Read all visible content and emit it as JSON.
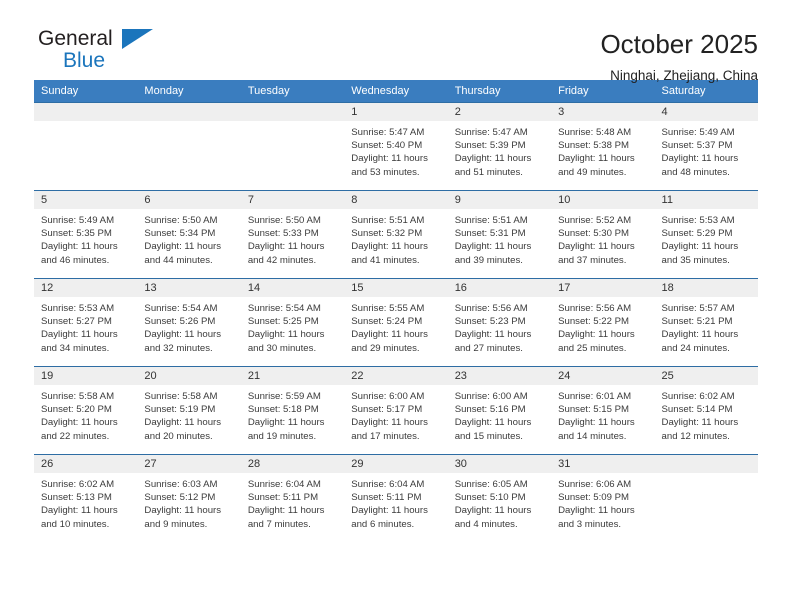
{
  "brand": {
    "name_part1": "General",
    "name_part2": "Blue",
    "accent_color": "#1b75bc",
    "logo_icon": "triangle-icon"
  },
  "header": {
    "title": "October 2025",
    "subtitle": "Ninghai, Zhejiang, China"
  },
  "calendar": {
    "header_bg": "#3a7dbf",
    "daynum_bg": "#efefef",
    "weekday_headers": [
      "Sunday",
      "Monday",
      "Tuesday",
      "Wednesday",
      "Thursday",
      "Friday",
      "Saturday"
    ],
    "weeks": [
      [
        {
          "day": "",
          "empty": true
        },
        {
          "day": "",
          "empty": true
        },
        {
          "day": "",
          "empty": true
        },
        {
          "day": "1",
          "sunrise": "Sunrise: 5:47 AM",
          "sunset": "Sunset: 5:40 PM",
          "daylight1": "Daylight: 11 hours",
          "daylight2": "and 53 minutes."
        },
        {
          "day": "2",
          "sunrise": "Sunrise: 5:47 AM",
          "sunset": "Sunset: 5:39 PM",
          "daylight1": "Daylight: 11 hours",
          "daylight2": "and 51 minutes."
        },
        {
          "day": "3",
          "sunrise": "Sunrise: 5:48 AM",
          "sunset": "Sunset: 5:38 PM",
          "daylight1": "Daylight: 11 hours",
          "daylight2": "and 49 minutes."
        },
        {
          "day": "4",
          "sunrise": "Sunrise: 5:49 AM",
          "sunset": "Sunset: 5:37 PM",
          "daylight1": "Daylight: 11 hours",
          "daylight2": "and 48 minutes."
        }
      ],
      [
        {
          "day": "5",
          "sunrise": "Sunrise: 5:49 AM",
          "sunset": "Sunset: 5:35 PM",
          "daylight1": "Daylight: 11 hours",
          "daylight2": "and 46 minutes."
        },
        {
          "day": "6",
          "sunrise": "Sunrise: 5:50 AM",
          "sunset": "Sunset: 5:34 PM",
          "daylight1": "Daylight: 11 hours",
          "daylight2": "and 44 minutes."
        },
        {
          "day": "7",
          "sunrise": "Sunrise: 5:50 AM",
          "sunset": "Sunset: 5:33 PM",
          "daylight1": "Daylight: 11 hours",
          "daylight2": "and 42 minutes."
        },
        {
          "day": "8",
          "sunrise": "Sunrise: 5:51 AM",
          "sunset": "Sunset: 5:32 PM",
          "daylight1": "Daylight: 11 hours",
          "daylight2": "and 41 minutes."
        },
        {
          "day": "9",
          "sunrise": "Sunrise: 5:51 AM",
          "sunset": "Sunset: 5:31 PM",
          "daylight1": "Daylight: 11 hours",
          "daylight2": "and 39 minutes."
        },
        {
          "day": "10",
          "sunrise": "Sunrise: 5:52 AM",
          "sunset": "Sunset: 5:30 PM",
          "daylight1": "Daylight: 11 hours",
          "daylight2": "and 37 minutes."
        },
        {
          "day": "11",
          "sunrise": "Sunrise: 5:53 AM",
          "sunset": "Sunset: 5:29 PM",
          "daylight1": "Daylight: 11 hours",
          "daylight2": "and 35 minutes."
        }
      ],
      [
        {
          "day": "12",
          "sunrise": "Sunrise: 5:53 AM",
          "sunset": "Sunset: 5:27 PM",
          "daylight1": "Daylight: 11 hours",
          "daylight2": "and 34 minutes."
        },
        {
          "day": "13",
          "sunrise": "Sunrise: 5:54 AM",
          "sunset": "Sunset: 5:26 PM",
          "daylight1": "Daylight: 11 hours",
          "daylight2": "and 32 minutes."
        },
        {
          "day": "14",
          "sunrise": "Sunrise: 5:54 AM",
          "sunset": "Sunset: 5:25 PM",
          "daylight1": "Daylight: 11 hours",
          "daylight2": "and 30 minutes."
        },
        {
          "day": "15",
          "sunrise": "Sunrise: 5:55 AM",
          "sunset": "Sunset: 5:24 PM",
          "daylight1": "Daylight: 11 hours",
          "daylight2": "and 29 minutes."
        },
        {
          "day": "16",
          "sunrise": "Sunrise: 5:56 AM",
          "sunset": "Sunset: 5:23 PM",
          "daylight1": "Daylight: 11 hours",
          "daylight2": "and 27 minutes."
        },
        {
          "day": "17",
          "sunrise": "Sunrise: 5:56 AM",
          "sunset": "Sunset: 5:22 PM",
          "daylight1": "Daylight: 11 hours",
          "daylight2": "and 25 minutes."
        },
        {
          "day": "18",
          "sunrise": "Sunrise: 5:57 AM",
          "sunset": "Sunset: 5:21 PM",
          "daylight1": "Daylight: 11 hours",
          "daylight2": "and 24 minutes."
        }
      ],
      [
        {
          "day": "19",
          "sunrise": "Sunrise: 5:58 AM",
          "sunset": "Sunset: 5:20 PM",
          "daylight1": "Daylight: 11 hours",
          "daylight2": "and 22 minutes."
        },
        {
          "day": "20",
          "sunrise": "Sunrise: 5:58 AM",
          "sunset": "Sunset: 5:19 PM",
          "daylight1": "Daylight: 11 hours",
          "daylight2": "and 20 minutes."
        },
        {
          "day": "21",
          "sunrise": "Sunrise: 5:59 AM",
          "sunset": "Sunset: 5:18 PM",
          "daylight1": "Daylight: 11 hours",
          "daylight2": "and 19 minutes."
        },
        {
          "day": "22",
          "sunrise": "Sunrise: 6:00 AM",
          "sunset": "Sunset: 5:17 PM",
          "daylight1": "Daylight: 11 hours",
          "daylight2": "and 17 minutes."
        },
        {
          "day": "23",
          "sunrise": "Sunrise: 6:00 AM",
          "sunset": "Sunset: 5:16 PM",
          "daylight1": "Daylight: 11 hours",
          "daylight2": "and 15 minutes."
        },
        {
          "day": "24",
          "sunrise": "Sunrise: 6:01 AM",
          "sunset": "Sunset: 5:15 PM",
          "daylight1": "Daylight: 11 hours",
          "daylight2": "and 14 minutes."
        },
        {
          "day": "25",
          "sunrise": "Sunrise: 6:02 AM",
          "sunset": "Sunset: 5:14 PM",
          "daylight1": "Daylight: 11 hours",
          "daylight2": "and 12 minutes."
        }
      ],
      [
        {
          "day": "26",
          "sunrise": "Sunrise: 6:02 AM",
          "sunset": "Sunset: 5:13 PM",
          "daylight1": "Daylight: 11 hours",
          "daylight2": "and 10 minutes."
        },
        {
          "day": "27",
          "sunrise": "Sunrise: 6:03 AM",
          "sunset": "Sunset: 5:12 PM",
          "daylight1": "Daylight: 11 hours",
          "daylight2": "and 9 minutes."
        },
        {
          "day": "28",
          "sunrise": "Sunrise: 6:04 AM",
          "sunset": "Sunset: 5:11 PM",
          "daylight1": "Daylight: 11 hours",
          "daylight2": "and 7 minutes."
        },
        {
          "day": "29",
          "sunrise": "Sunrise: 6:04 AM",
          "sunset": "Sunset: 5:11 PM",
          "daylight1": "Daylight: 11 hours",
          "daylight2": "and 6 minutes."
        },
        {
          "day": "30",
          "sunrise": "Sunrise: 6:05 AM",
          "sunset": "Sunset: 5:10 PM",
          "daylight1": "Daylight: 11 hours",
          "daylight2": "and 4 minutes."
        },
        {
          "day": "31",
          "sunrise": "Sunrise: 6:06 AM",
          "sunset": "Sunset: 5:09 PM",
          "daylight1": "Daylight: 11 hours",
          "daylight2": "and 3 minutes."
        },
        {
          "day": "",
          "empty": true
        }
      ]
    ]
  }
}
